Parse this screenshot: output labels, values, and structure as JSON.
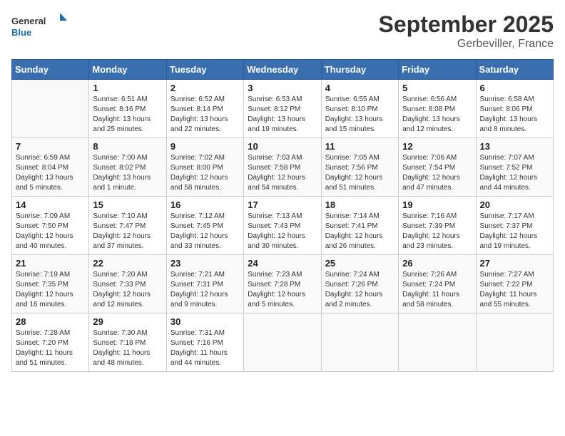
{
  "header": {
    "logo_general": "General",
    "logo_blue": "Blue",
    "title": "September 2025",
    "location": "Gerbeviller, France"
  },
  "weekdays": [
    "Sunday",
    "Monday",
    "Tuesday",
    "Wednesday",
    "Thursday",
    "Friday",
    "Saturday"
  ],
  "weeks": [
    [
      {
        "day": "",
        "info": ""
      },
      {
        "day": "1",
        "info": "Sunrise: 6:51 AM\nSunset: 8:16 PM\nDaylight: 13 hours\nand 25 minutes."
      },
      {
        "day": "2",
        "info": "Sunrise: 6:52 AM\nSunset: 8:14 PM\nDaylight: 13 hours\nand 22 minutes."
      },
      {
        "day": "3",
        "info": "Sunrise: 6:53 AM\nSunset: 8:12 PM\nDaylight: 13 hours\nand 19 minutes."
      },
      {
        "day": "4",
        "info": "Sunrise: 6:55 AM\nSunset: 8:10 PM\nDaylight: 13 hours\nand 15 minutes."
      },
      {
        "day": "5",
        "info": "Sunrise: 6:56 AM\nSunset: 8:08 PM\nDaylight: 13 hours\nand 12 minutes."
      },
      {
        "day": "6",
        "info": "Sunrise: 6:58 AM\nSunset: 8:06 PM\nDaylight: 13 hours\nand 8 minutes."
      }
    ],
    [
      {
        "day": "7",
        "info": "Sunrise: 6:59 AM\nSunset: 8:04 PM\nDaylight: 13 hours\nand 5 minutes."
      },
      {
        "day": "8",
        "info": "Sunrise: 7:00 AM\nSunset: 8:02 PM\nDaylight: 13 hours\nand 1 minute."
      },
      {
        "day": "9",
        "info": "Sunrise: 7:02 AM\nSunset: 8:00 PM\nDaylight: 12 hours\nand 58 minutes."
      },
      {
        "day": "10",
        "info": "Sunrise: 7:03 AM\nSunset: 7:58 PM\nDaylight: 12 hours\nand 54 minutes."
      },
      {
        "day": "11",
        "info": "Sunrise: 7:05 AM\nSunset: 7:56 PM\nDaylight: 12 hours\nand 51 minutes."
      },
      {
        "day": "12",
        "info": "Sunrise: 7:06 AM\nSunset: 7:54 PM\nDaylight: 12 hours\nand 47 minutes."
      },
      {
        "day": "13",
        "info": "Sunrise: 7:07 AM\nSunset: 7:52 PM\nDaylight: 12 hours\nand 44 minutes."
      }
    ],
    [
      {
        "day": "14",
        "info": "Sunrise: 7:09 AM\nSunset: 7:50 PM\nDaylight: 12 hours\nand 40 minutes."
      },
      {
        "day": "15",
        "info": "Sunrise: 7:10 AM\nSunset: 7:47 PM\nDaylight: 12 hours\nand 37 minutes."
      },
      {
        "day": "16",
        "info": "Sunrise: 7:12 AM\nSunset: 7:45 PM\nDaylight: 12 hours\nand 33 minutes."
      },
      {
        "day": "17",
        "info": "Sunrise: 7:13 AM\nSunset: 7:43 PM\nDaylight: 12 hours\nand 30 minutes."
      },
      {
        "day": "18",
        "info": "Sunrise: 7:14 AM\nSunset: 7:41 PM\nDaylight: 12 hours\nand 26 minutes."
      },
      {
        "day": "19",
        "info": "Sunrise: 7:16 AM\nSunset: 7:39 PM\nDaylight: 12 hours\nand 23 minutes."
      },
      {
        "day": "20",
        "info": "Sunrise: 7:17 AM\nSunset: 7:37 PM\nDaylight: 12 hours\nand 19 minutes."
      }
    ],
    [
      {
        "day": "21",
        "info": "Sunrise: 7:19 AM\nSunset: 7:35 PM\nDaylight: 12 hours\nand 16 minutes."
      },
      {
        "day": "22",
        "info": "Sunrise: 7:20 AM\nSunset: 7:33 PM\nDaylight: 12 hours\nand 12 minutes."
      },
      {
        "day": "23",
        "info": "Sunrise: 7:21 AM\nSunset: 7:31 PM\nDaylight: 12 hours\nand 9 minutes."
      },
      {
        "day": "24",
        "info": "Sunrise: 7:23 AM\nSunset: 7:28 PM\nDaylight: 12 hours\nand 5 minutes."
      },
      {
        "day": "25",
        "info": "Sunrise: 7:24 AM\nSunset: 7:26 PM\nDaylight: 12 hours\nand 2 minutes."
      },
      {
        "day": "26",
        "info": "Sunrise: 7:26 AM\nSunset: 7:24 PM\nDaylight: 11 hours\nand 58 minutes."
      },
      {
        "day": "27",
        "info": "Sunrise: 7:27 AM\nSunset: 7:22 PM\nDaylight: 11 hours\nand 55 minutes."
      }
    ],
    [
      {
        "day": "28",
        "info": "Sunrise: 7:28 AM\nSunset: 7:20 PM\nDaylight: 11 hours\nand 51 minutes."
      },
      {
        "day": "29",
        "info": "Sunrise: 7:30 AM\nSunset: 7:18 PM\nDaylight: 11 hours\nand 48 minutes."
      },
      {
        "day": "30",
        "info": "Sunrise: 7:31 AM\nSunset: 7:16 PM\nDaylight: 11 hours\nand 44 minutes."
      },
      {
        "day": "",
        "info": ""
      },
      {
        "day": "",
        "info": ""
      },
      {
        "day": "",
        "info": ""
      },
      {
        "day": "",
        "info": ""
      }
    ]
  ]
}
